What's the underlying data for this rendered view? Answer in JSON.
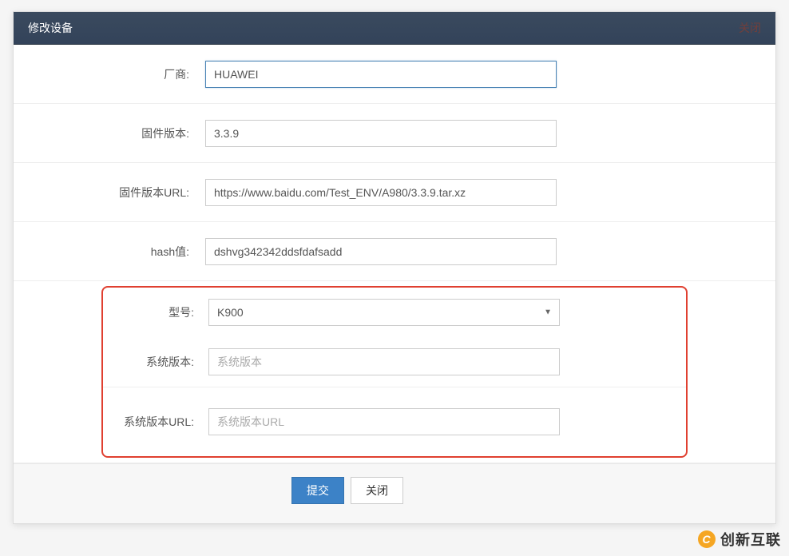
{
  "modal": {
    "title": "修改设备",
    "close_label": "关闭"
  },
  "form": {
    "vendor": {
      "label": "厂商:",
      "value": "HUAWEI"
    },
    "firmware_version": {
      "label": "固件版本:",
      "value": "3.3.9"
    },
    "firmware_url": {
      "label": "固件版本URL:",
      "value": "https://www.baidu.com/Test_ENV/A980/3.3.9.tar.xz"
    },
    "hash": {
      "label": "hash值:",
      "value": "dshvg342342ddsfdafsadd"
    },
    "model": {
      "label": "型号:",
      "value": "K900"
    },
    "sys_version": {
      "label": "系统版本:",
      "value": "",
      "placeholder": "系统版本"
    },
    "sys_version_url": {
      "label": "系统版本URL:",
      "value": "",
      "placeholder": "系统版本URL"
    }
  },
  "buttons": {
    "submit": "提交",
    "close": "关闭"
  },
  "watermark": {
    "icon": "C",
    "text": "创新互联"
  }
}
